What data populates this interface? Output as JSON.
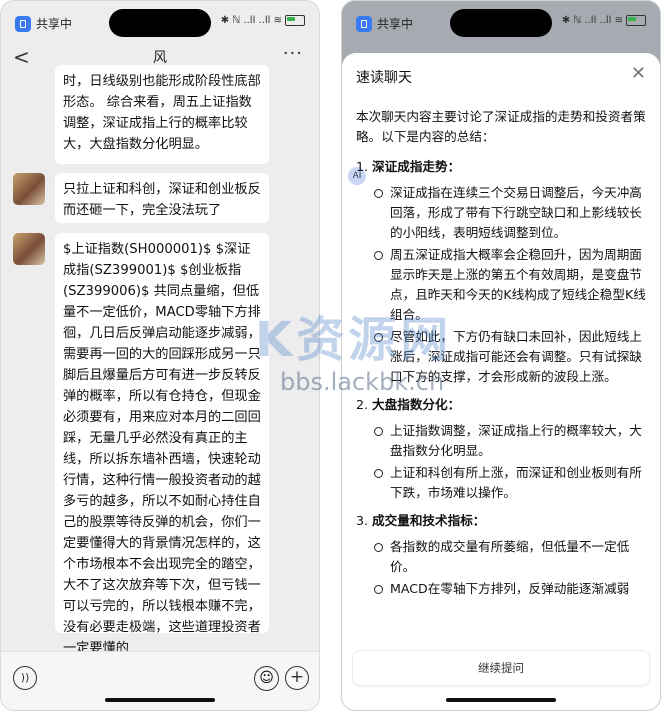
{
  "status": {
    "share_label": "共享中",
    "indicators": "✱ ℕ ..ll ..ll ≋"
  },
  "chat": {
    "title": "风",
    "back": "<",
    "more": "···",
    "messages": [
      {
        "text": "时，日线级别也能形成阶段性底部形态。 综合来看，周五上证指数调整，深证成指上行的概率比较大，大盘指数分化明显。"
      },
      {
        "text": "只拉上证和科创，深证和创业板反而还砸一下，完全没法玩了"
      },
      {
        "text": "$上证指数(SH000001)$ $深证成指(SZ399001)$ $创业板指(SZ399006)$ 共同点量缩，但低量不一定低价，MACD零轴下方排徊，几日后反弹启动能逐步减弱，需要再一回的大的回踩形成另一只脚后且爆量后方可有进一步反转反弹的概率，所以有仓持仓，但现金必须要有，用来应对本月的二回回踩，无量几乎必然没有真正的主线，所以拆东墙补西墙，快速轮动行情，这种行情一般投资者动的越多亏的越多，所以不如耐心持住自己的股票等待反弹的机会，你们一定要懂得大的背景情况怎样的，这个市场根本不会出现完全的踏空，大不了这次放弃等下次，但亏钱一可以亏完的，所以钱根本赚不完，没有必要走极端，这些道理投资者一定要懂的"
      }
    ]
  },
  "summary": {
    "title": "速读聊天",
    "close": "✕",
    "intro": "本次聊天内容主要讨论了深证成指的走势和投资者策略。以下是内容的总结：",
    "sections": [
      {
        "num": "1.",
        "heading": "深证成指走势：",
        "items": [
          "深证成指在连续三个交易日调整后，今天冲高回落，形成了带有下行跳空缺口和上影线较长的小阳线，表明短线调整到位。",
          "周五深证成指大概率会企稳回升，因为周期面显示昨天是上涨的第五个有效周期，是变盘节点，且昨天和今天的K线构成了短线企稳型K线组合。",
          "尽管如此，下方仍有缺口未回补，因此短线上涨后，深证成指可能还会有调整。只有试探缺口下方的支撑，才会形成新的波段上涨。"
        ]
      },
      {
        "num": "2.",
        "heading": "大盘指数分化：",
        "items": [
          "上证指数调整，深证成指上行的概率较大，大盘指数分化明显。",
          "上证和科创有所上涨，而深证和创业板则有所下跌，市场难以操作。"
        ]
      },
      {
        "num": "3.",
        "heading": "成交量和技术指标：",
        "items": [
          "各指数的成交量有所萎缩，但低量不一定低价。",
          "MACD在零轴下方排列，反弹动能逐渐减弱"
        ]
      }
    ],
    "continue_label": "继续提问"
  },
  "watermark": {
    "brand": "K资源网",
    "url": "bbs.lackbk.cn"
  },
  "colors": {
    "accent": "#3a7af0",
    "chat_bg": "#ededed",
    "bubble": "#ffffff"
  }
}
